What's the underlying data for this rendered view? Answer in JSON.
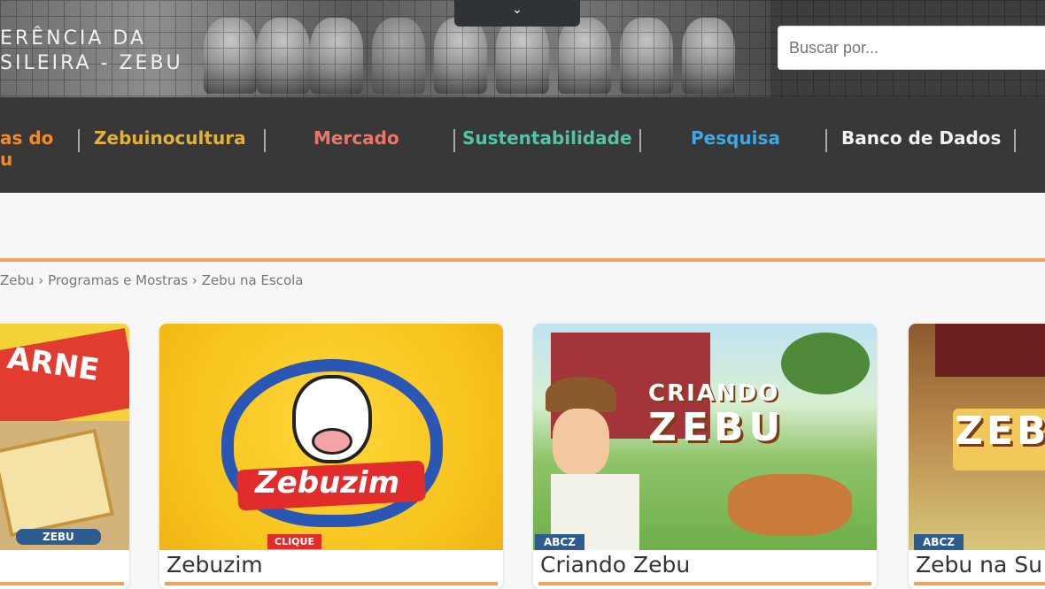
{
  "header": {
    "brand_line1": "ERÊNCIA DA",
    "brand_line2": "SILEIRA - ZEBU",
    "toggle_icon": "chevron-down",
    "toggle_glyph": "⌄",
    "search_placeholder": "Buscar por..."
  },
  "nav": {
    "items": [
      {
        "line1": "as do",
        "line2": "u",
        "color": "#f08a2a"
      },
      {
        "label": "Zebuinocultura",
        "color": "#e2b13c"
      },
      {
        "label": "Mercado",
        "color": "#e8776b"
      },
      {
        "label": "Sustentabilidade",
        "color": "#55c3a8"
      },
      {
        "label": "Pesquisa",
        "color": "#3fa7e6"
      },
      {
        "label": "Banco de Dados",
        "color": "#f2f2f2"
      }
    ]
  },
  "breadcrumb": {
    "text": "Zebu › Programas e Mostras › Zebu na Escola"
  },
  "cards": [
    {
      "title": "",
      "art_text": "ARNE",
      "badge": "ZEBU"
    },
    {
      "title": "Zebuzim",
      "art_text": "Zebuzim",
      "badge": "CLIQUE"
    },
    {
      "title": "Criando Zebu",
      "art_text_1": "CRIANDO",
      "art_text_2": "ZEBU",
      "badge": "ABCZ"
    },
    {
      "title": "Zebu na Su",
      "art_text": "ZEB",
      "badge": "ABCZ"
    }
  ]
}
